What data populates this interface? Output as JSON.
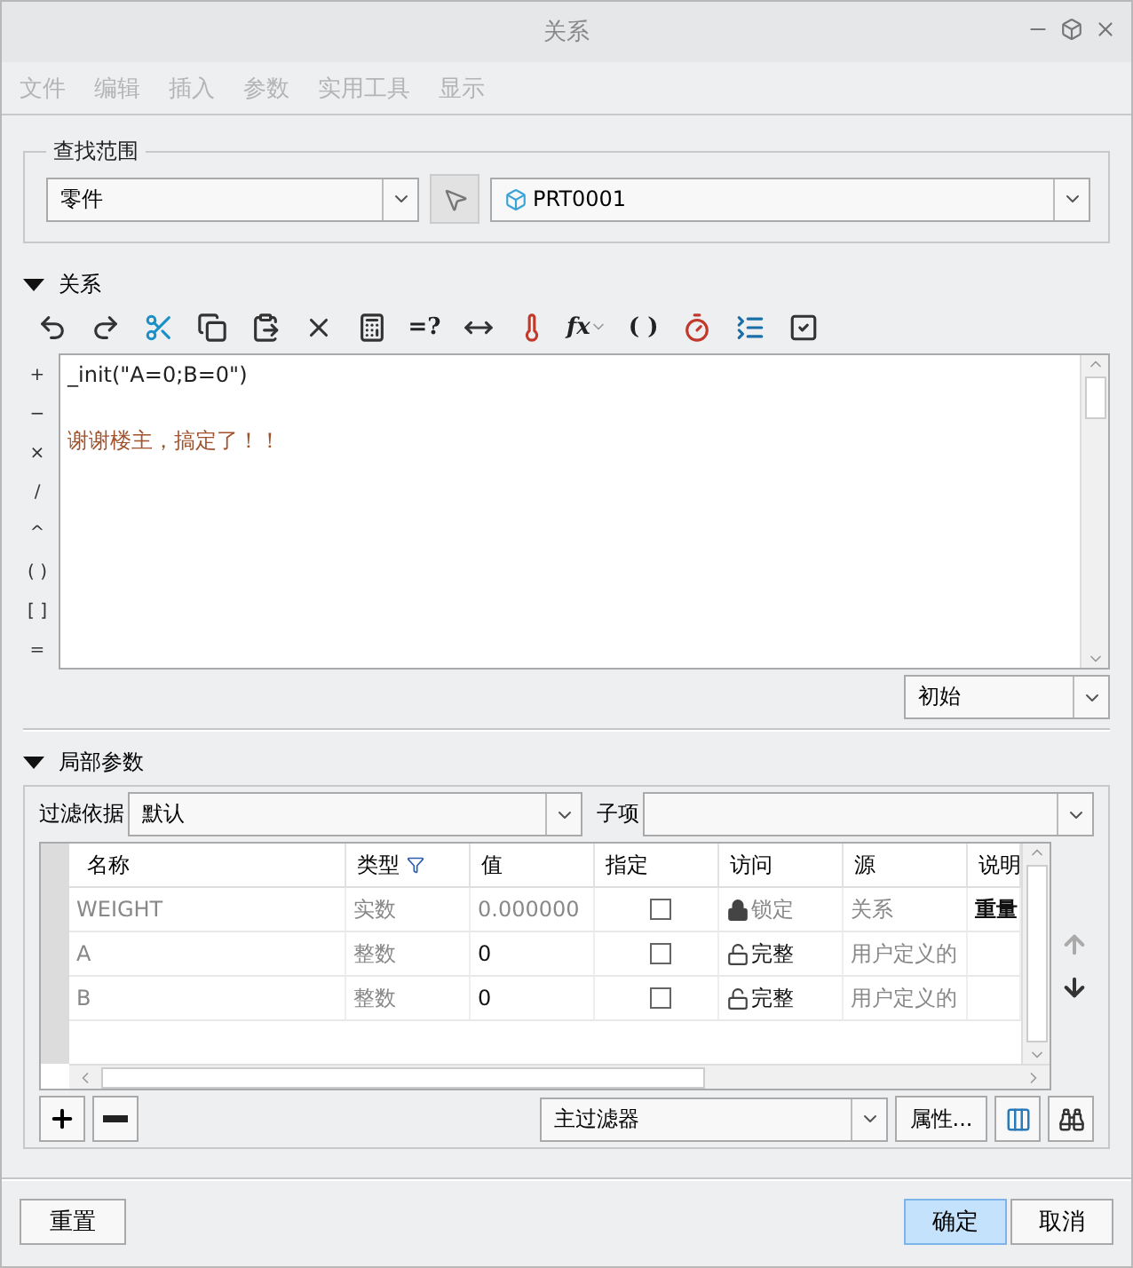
{
  "window": {
    "title": "关系"
  },
  "menu": [
    {
      "label": "文件",
      "disabled": true
    },
    {
      "label": "编辑",
      "disabled": true
    },
    {
      "label": "插入",
      "disabled": true
    },
    {
      "label": "参数",
      "disabled": true
    },
    {
      "label": "实用工具",
      "disabled": true
    },
    {
      "label": "显示",
      "disabled": true
    }
  ],
  "lookup": {
    "title": "查找范围",
    "type_value": "零件",
    "model_value": "PRT0001"
  },
  "relations": {
    "title": "关系",
    "expanded": true,
    "toolbar": [
      {
        "kind": "undo"
      },
      {
        "kind": "redo"
      },
      {
        "kind": "cut"
      },
      {
        "kind": "copy"
      },
      {
        "kind": "paste"
      },
      {
        "kind": "delete"
      },
      {
        "kind": "units"
      },
      {
        "kind": "text",
        "label": "=?"
      },
      {
        "kind": "measure"
      },
      {
        "kind": "thermo"
      },
      {
        "kind": "function",
        "label": "fx"
      },
      {
        "kind": "text",
        "label": "( )"
      },
      {
        "kind": "timer"
      },
      {
        "kind": "list"
      },
      {
        "kind": "verify"
      }
    ],
    "operators": [
      "+",
      "−",
      "×",
      "/",
      "^",
      "( )",
      "[ ]",
      "="
    ],
    "lines": [
      {
        "text": "_init(\"A=0;B=0\")",
        "blank_before": false
      },
      {
        "text": "谢谢楼主，搞定了！！",
        "blank_before": true
      }
    ],
    "mode_value": "初始"
  },
  "local_params": {
    "title": "局部参数",
    "expanded": true,
    "filter_label": "过滤依据",
    "filter_value": "默认",
    "child_label": "子项",
    "columns": [
      "名称",
      "类型",
      "值",
      "指定",
      "访问",
      "源",
      "说明"
    ],
    "rows": [
      {
        "name": "WEIGHT",
        "type": "实数",
        "value": "0.000000",
        "value_dim": true,
        "designated": false,
        "access": "锁定",
        "locked": true,
        "source": "关系",
        "description": "重量"
      },
      {
        "name": "A",
        "type": "整数",
        "value": "0",
        "value_dim": false,
        "designated": false,
        "access": "完整",
        "locked": false,
        "source": "用户定义的"
      },
      {
        "name": "B",
        "type": "整数",
        "value": "0",
        "value_dim": false,
        "designated": false,
        "access": "完整",
        "locked": false,
        "source": "用户定义的"
      }
    ],
    "main_filter": "主过滤器",
    "properties_button": "属性..."
  },
  "footer": {
    "reset": "重置",
    "buttons": [
      {
        "label": "确定",
        "default": true
      },
      {
        "label": "取消",
        "default": false
      }
    ]
  }
}
